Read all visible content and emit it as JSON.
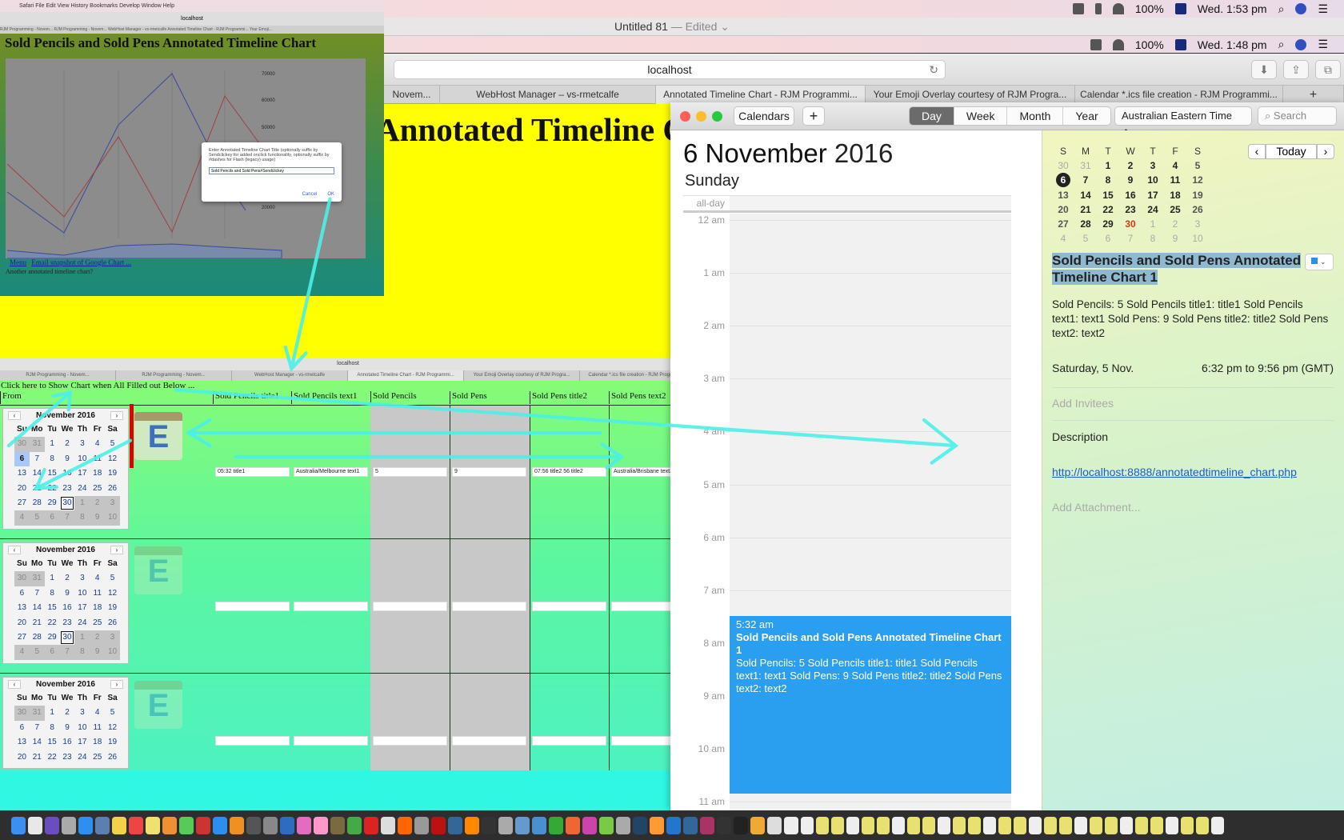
{
  "menubar_top": {
    "battery": "100%",
    "clock": "Wed. 1:53 pm"
  },
  "titlebar": {
    "title": "Untitled 81",
    "edited": "— Edited ⌄"
  },
  "menubar_second": {
    "battery": "100%",
    "clock": "Wed. 1:48 pm"
  },
  "safari": {
    "url": "localhost",
    "tabs": [
      {
        "label": "Novem..."
      },
      {
        "label": "WebHost Manager – vs-rmetcalfe"
      },
      {
        "label": "Annotated Timeline Chart - RJM Programmi...",
        "active": true
      },
      {
        "label": "Your Emoji Overlay courtesy of RJM Progra..."
      },
      {
        "label": "Calendar *.ics file creation - RJM Programmi..."
      }
    ],
    "new_tab": "+"
  },
  "page": {
    "heading": "Annotated Timeline C"
  },
  "inset_chart": {
    "menu": "Safari  File  Edit  View  History  Bookmarks  Develop  Window  Help",
    "url": "localhost",
    "tabs": "RJM Programming - Novem...   RJM Programming - Novem...   WebHost Manager - vs-rmetcalfe   Annotated Timeline Chart - RJM Programmi...   Your Emoji...",
    "title": "Sold Pencils and Sold Pens Annotated Timeline Chart",
    "y_ticks": [
      "70000",
      "60000",
      "50000",
      "20000"
    ],
    "dialog": {
      "prompt": "Enter Annotated Timeline Chart Title (optionally suffix by Sendclickey for added onclick functionality, optionally suffix by #dashes for Flash (legacy) usage)",
      "value": "Sold Pencils and Sold Pens#Sendclickey",
      "cancel": "Cancel",
      "ok": "OK"
    },
    "links": [
      "Menu",
      "Email snapshot of Google Chart ..."
    ],
    "footer_text": "Another annotated timeline chart?"
  },
  "inset_form": {
    "url": "localhost",
    "tabs": [
      "RJM Programming - Novem...",
      "RJM Programming - Novem...",
      "WebHost Manager - vs-rmetcalfe",
      "Annotated Timeline Chart - RJM Programmi...",
      "Your Emoji Overlay courtesy of RJM Progra...",
      "Calendar *.ics file creation - RJM Programmi..."
    ],
    "click_here": "Click here to Show Chart when All Filled out Below ...",
    "columns": [
      "From",
      "Sold Pencils title1",
      "Sold Pencils text1",
      "Sold Pencils",
      "Sold Pens",
      "Sold Pens title2",
      "Sold Pens text2"
    ],
    "row1_values": [
      "05:32 title1",
      "Australia/Melbourne text1",
      "5",
      "9",
      "07:56 title2 56 title2",
      "Australia/Brisbane text2"
    ],
    "calendar": {
      "month": "November 2016",
      "weekdays": [
        "Su",
        "Mo",
        "Tu",
        "We",
        "Th",
        "Fr",
        "Sa"
      ],
      "weeks": [
        [
          "30",
          "31",
          "1",
          "2",
          "3",
          "4",
          "5"
        ],
        [
          "6",
          "7",
          "8",
          "9",
          "10",
          "11",
          "12"
        ],
        [
          "13",
          "14",
          "15",
          "16",
          "17",
          "18",
          "19"
        ],
        [
          "20",
          "21",
          "22",
          "23",
          "24",
          "25",
          "26"
        ],
        [
          "27",
          "28",
          "29",
          "30",
          "1",
          "2",
          "3"
        ],
        [
          "4",
          "5",
          "6",
          "7",
          "8",
          "9",
          "10"
        ]
      ]
    },
    "icon_letter": "E"
  },
  "calendar_app": {
    "toolbar": {
      "calendars": "Calendars",
      "add": "+",
      "views": [
        "Day",
        "Week",
        "Month",
        "Year"
      ],
      "active_view": "Day",
      "timezone": "Australian Eastern Time ⌃⌄",
      "search_placeholder": "Search"
    },
    "date": {
      "day_month": "6 November",
      "year": "2016",
      "weekday": "Sunday"
    },
    "all_day": "all-day",
    "hours": [
      "12 am",
      "1 am",
      "2 am",
      "3 am",
      "4 am",
      "5 am",
      "6 am",
      "7 am",
      "8 am",
      "9 am",
      "10 am",
      "11 am"
    ],
    "event": {
      "time": "5:32 am",
      "title": "Sold Pencils and Sold Pens Annotated Timeline Chart 1",
      "description": "Sold Pencils: 5 Sold Pencils title1: title1 Sold Pencils text1: text1 Sold Pens: 9 Sold Pens title2: title2 Sold Pens text2: text2",
      "color": "#2a9ff0"
    },
    "mini_calendar": {
      "weekdays": [
        "S",
        "M",
        "T",
        "W",
        "T",
        "F",
        "S"
      ],
      "weeks": [
        [
          "30",
          "31",
          "1",
          "2",
          "3",
          "4",
          "5"
        ],
        [
          "6",
          "7",
          "8",
          "9",
          "10",
          "11",
          "12"
        ],
        [
          "13",
          "14",
          "15",
          "16",
          "17",
          "18",
          "19"
        ],
        [
          "20",
          "21",
          "22",
          "23",
          "24",
          "25",
          "26"
        ],
        [
          "27",
          "28",
          "29",
          "30",
          "1",
          "2",
          "3"
        ],
        [
          "4",
          "5",
          "6",
          "7",
          "8",
          "9",
          "10"
        ]
      ],
      "selected": "6",
      "today": "30",
      "today_label": "Today",
      "prev": "‹",
      "next": "›"
    },
    "inspector": {
      "title": "Sold Pencils and Sold Pens Annotated Timeline Chart 1",
      "notes": "Sold Pencils: 5 Sold Pencils title1: title1 Sold Pencils text1: text1 Sold Pens: 9 Sold Pens title2: title2 Sold Pens text2: text2",
      "date": "Saturday, 5 Nov.",
      "time_range": "6:32 pm to 9:56 pm (GMT)",
      "add_invitees": "Add Invitees",
      "description_label": "Description",
      "url": "http://localhost:8888/annotatedtimeline_chart.php",
      "add_attachment": "Add Attachment..."
    }
  },
  "colors": {
    "annotation_arrow": "#4df0e8",
    "page_yellow": "#ffff00",
    "event_blue": "#2a9ff0"
  },
  "dock": {
    "icons": [
      "finder",
      "document",
      "siri",
      "launchpad",
      "safari",
      "preview",
      "notes",
      "calendar",
      "stickies",
      "photos",
      "messages",
      "photo-booth",
      "app-store",
      "ibooks",
      "stopwatch",
      "magnifier",
      "xcode",
      "itunes",
      "music",
      "gimp",
      "chrome",
      "opera",
      "textedit",
      "avast",
      "archive",
      "filezilla",
      "camino",
      "vlc",
      "terminal",
      "help",
      "virtualbox",
      "textwrangler",
      "vim",
      "firefox",
      "scribus",
      "android",
      "help2",
      "network",
      "sublime",
      "visual-studio-code",
      "dropbox",
      "amp",
      "github",
      "console",
      "mamp",
      "folders",
      "trash"
    ]
  }
}
